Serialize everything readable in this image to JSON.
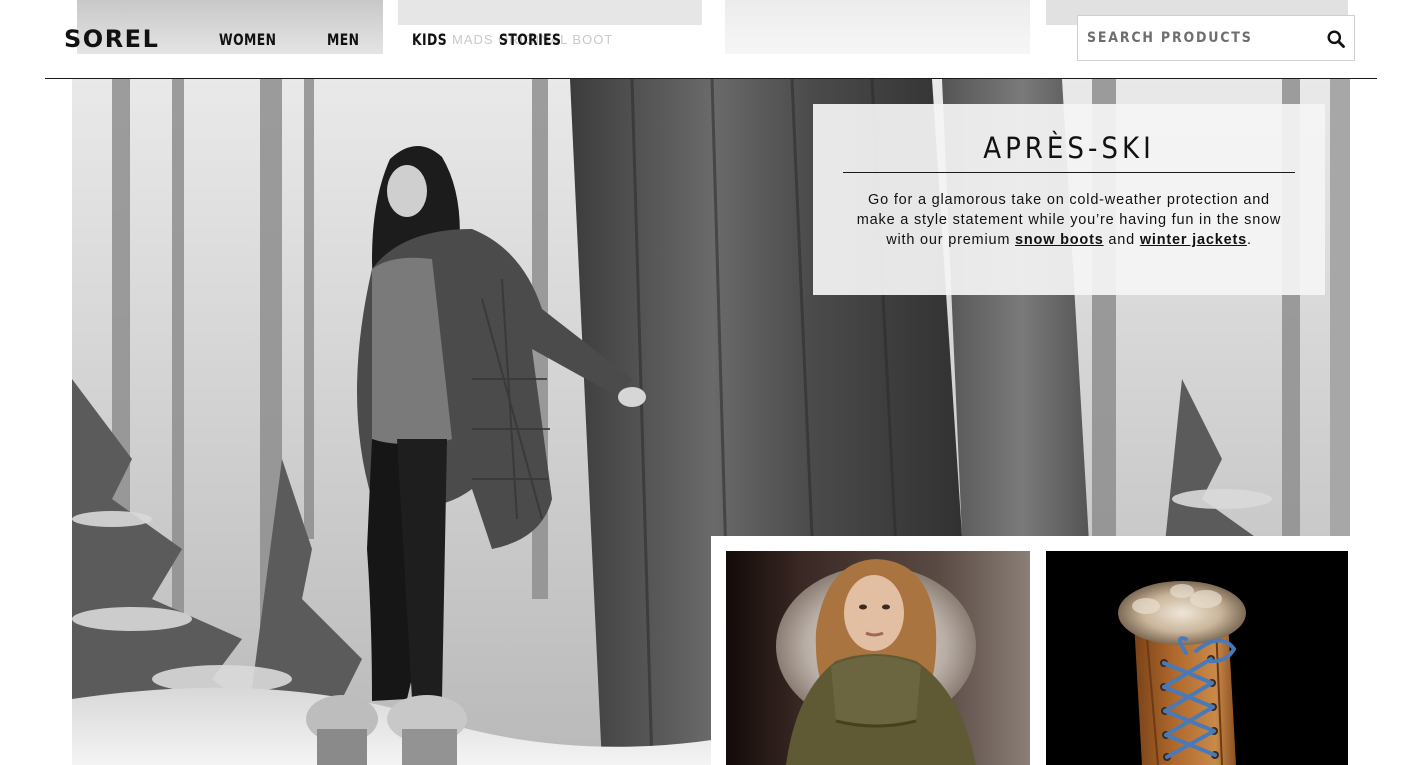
{
  "background_row": {
    "faded_label": "MADS ORIGINAL BOOT"
  },
  "header": {
    "logo": "SOREL",
    "nav": [
      "WOMEN",
      "MEN",
      "KIDS",
      "STORIES"
    ],
    "search": {
      "placeholder": "SEARCH PRODUCTS"
    }
  },
  "hero": {
    "image_alt": "Woman in parka and fur-trimmed boots in a snowy forest",
    "promo": {
      "title": "APRÈS-SKI",
      "body_before": "Go for a glamorous take on cold-weather protection and make a style statement while you’re having fun in the snow with our premium ",
      "link_boots": "snow boots",
      "body_middle": " and ",
      "link_jackets": "winter jackets",
      "body_after": "."
    }
  },
  "tiles": [
    {
      "alt": "Model in olive parka with fur-trimmed hood"
    },
    {
      "alt": "Tall tan boot with fur cuff and blue laces"
    }
  ],
  "colors": {
    "text": "#111111",
    "promo_bg": "#f4f4f4",
    "boot_leather": "#b0692c",
    "lace_blue": "#4a79b8",
    "parka_olive": "#5f5a33"
  }
}
